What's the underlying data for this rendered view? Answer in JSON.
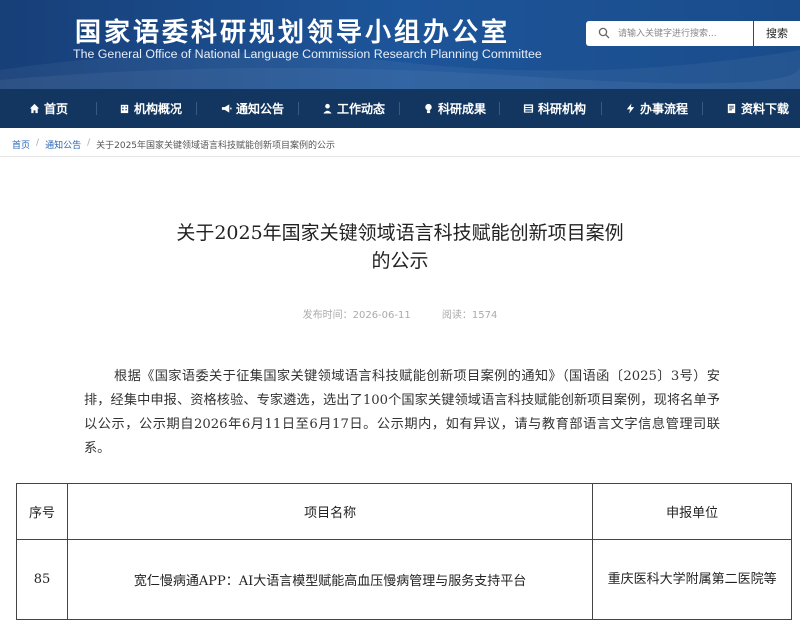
{
  "header": {
    "title": "国家语委科研规划领导小组办公室",
    "subtitle": "The General Office of National Language Commission Research Planning Committee",
    "search_placeholder": "请输入关键字进行搜索...",
    "search_button": "搜索",
    "bg_color": "#1a4c8b"
  },
  "nav": {
    "bg_color": "#12365f",
    "items": [
      {
        "label": "首页",
        "icon": "home-icon"
      },
      {
        "label": "机构概况",
        "icon": "building-icon"
      },
      {
        "label": "通知公告",
        "icon": "megaphone-icon"
      },
      {
        "label": "工作动态",
        "icon": "person-icon"
      },
      {
        "label": "科研成果",
        "icon": "lightbulb-icon"
      },
      {
        "label": "科研机构",
        "icon": "institution-icon"
      },
      {
        "label": "办事流程",
        "icon": "workflow-icon"
      },
      {
        "label": "资料下载",
        "icon": "download-icon"
      }
    ]
  },
  "breadcrumb": {
    "home": "首页",
    "section": "通知公告",
    "current": "关于2025年国家关键领域语言科技赋能创新项目案例的公示"
  },
  "article": {
    "title_line1": "关于2025年国家关键领域语言科技赋能创新项目案例",
    "title_line2": "的公示",
    "published": "发布时间：2026-06-11",
    "views": "阅读：1574",
    "body": "根据《国家语委关于征集国家关键领域语言科技赋能创新项目案例的通知》（国语函〔2025〕3号）安排，经集中申报、资格核验、专家遴选，选出了100个国家关键领域语言科技赋能创新项目案例，现将名单予以公示，公示期自2026年6月11日至6月17日。公示期内，如有异议，请与教育部语言文字信息管理司联系。"
  },
  "table": {
    "headers": [
      "序号",
      "项目名称",
      "申报单位"
    ],
    "rows": [
      {
        "no": "85",
        "name": "宽仁慢病通APP：AI大语言模型赋能高血压慢病管理与服务支持平台",
        "unit": "重庆医科大学附属第二医院等"
      }
    ]
  }
}
